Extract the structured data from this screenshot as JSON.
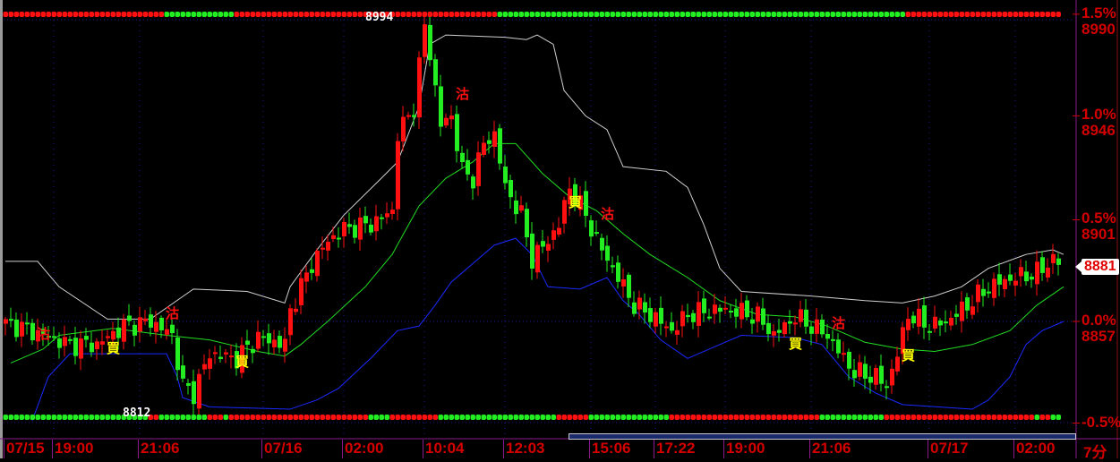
{
  "chart_data": {
    "type": "candlestick",
    "bar_count": 197,
    "closes_keypoints": [
      [
        1,
        8856
      ],
      [
        7,
        8851
      ],
      [
        12,
        8847
      ],
      [
        17,
        8847
      ],
      [
        22,
        8855
      ],
      [
        27,
        8857
      ],
      [
        31,
        8851
      ],
      [
        33,
        8829
      ],
      [
        35,
        8826
      ],
      [
        38,
        8843
      ],
      [
        43,
        8841
      ],
      [
        47,
        8850
      ],
      [
        52,
        8847
      ],
      [
        53,
        8862
      ],
      [
        57,
        8882
      ],
      [
        60,
        8892
      ],
      [
        63,
        8897
      ],
      [
        68,
        8899
      ],
      [
        72,
        8905
      ],
      [
        73,
        8938
      ],
      [
        76,
        8950
      ],
      [
        78,
        8985
      ],
      [
        79,
        8973
      ],
      [
        81,
        8942
      ],
      [
        83,
        8946
      ],
      [
        85,
        8922
      ],
      [
        87,
        8919
      ],
      [
        89,
        8934
      ],
      [
        91,
        8938
      ],
      [
        93,
        8915
      ],
      [
        96,
        8903
      ],
      [
        98,
        8884
      ],
      [
        101,
        8892
      ],
      [
        103,
        8899
      ],
      [
        105,
        8915
      ],
      [
        108,
        8903
      ],
      [
        110,
        8892
      ],
      [
        113,
        8880
      ],
      [
        117,
        8864
      ],
      [
        120,
        8860
      ],
      [
        124,
        8853
      ],
      [
        127,
        8860
      ],
      [
        132,
        8862
      ],
      [
        135,
        8862
      ],
      [
        140,
        8859
      ],
      [
        143,
        8851
      ],
      [
        147,
        8859
      ],
      [
        150,
        8855
      ],
      [
        153,
        8851
      ],
      [
        156,
        8841
      ],
      [
        158,
        8835
      ],
      [
        162,
        8833
      ],
      [
        164,
        8829
      ],
      [
        166,
        8843
      ],
      [
        168,
        8860
      ],
      [
        172,
        8855
      ],
      [
        175,
        8857
      ],
      [
        178,
        8862
      ],
      [
        182,
        8870
      ],
      [
        185,
        8874
      ],
      [
        188,
        8876
      ],
      [
        192,
        8878
      ],
      [
        195,
        8884
      ],
      [
        197,
        8881
      ]
    ],
    "upper_band": [
      [
        0,
        8883
      ],
      [
        6,
        8883
      ],
      [
        10,
        8872
      ],
      [
        19,
        8858
      ],
      [
        27,
        8858
      ],
      [
        35,
        8871
      ],
      [
        45,
        8870
      ],
      [
        52,
        8865
      ],
      [
        53,
        8872
      ],
      [
        58,
        8888
      ],
      [
        63,
        8903
      ],
      [
        70,
        8919
      ],
      [
        73,
        8926
      ],
      [
        77,
        8950
      ],
      [
        79,
        8977
      ],
      [
        82,
        8981
      ],
      [
        93,
        8980
      ],
      [
        97,
        8979
      ],
      [
        99,
        8981
      ],
      [
        102,
        8977
      ],
      [
        104,
        8957
      ],
      [
        108,
        8946
      ],
      [
        112,
        8940
      ],
      [
        115,
        8924
      ],
      [
        123,
        8922
      ],
      [
        127,
        8915
      ],
      [
        130,
        8899
      ],
      [
        133,
        8880
      ],
      [
        137,
        8870
      ],
      [
        150,
        8868
      ],
      [
        160,
        8866
      ],
      [
        167,
        8865
      ],
      [
        173,
        8868
      ],
      [
        178,
        8872
      ],
      [
        183,
        8880
      ],
      [
        190,
        8886
      ],
      [
        195,
        8888
      ],
      [
        197,
        8886
      ]
    ],
    "middle_band": [
      [
        1,
        8839
      ],
      [
        7,
        8845
      ],
      [
        10,
        8851
      ],
      [
        20,
        8854
      ],
      [
        30,
        8851
      ],
      [
        38,
        8849
      ],
      [
        47,
        8844
      ],
      [
        52,
        8842
      ],
      [
        55,
        8847
      ],
      [
        60,
        8857
      ],
      [
        67,
        8872
      ],
      [
        72,
        8886
      ],
      [
        77,
        8907
      ],
      [
        82,
        8919
      ],
      [
        87,
        8926
      ],
      [
        91,
        8934
      ],
      [
        95,
        8934
      ],
      [
        100,
        8921
      ],
      [
        105,
        8911
      ],
      [
        110,
        8905
      ],
      [
        115,
        8895
      ],
      [
        120,
        8886
      ],
      [
        127,
        8876
      ],
      [
        133,
        8866
      ],
      [
        140,
        8860
      ],
      [
        147,
        8859
      ],
      [
        153,
        8855
      ],
      [
        160,
        8848
      ],
      [
        167,
        8845
      ],
      [
        173,
        8844
      ],
      [
        180,
        8847
      ],
      [
        187,
        8853
      ],
      [
        192,
        8864
      ],
      [
        197,
        8872
      ]
    ],
    "lower_band": [
      [
        5,
        8814
      ],
      [
        8,
        8833
      ],
      [
        12,
        8843
      ],
      [
        30,
        8843
      ],
      [
        32,
        8833
      ],
      [
        33,
        8824
      ],
      [
        38,
        8820
      ],
      [
        53,
        8819
      ],
      [
        58,
        8823
      ],
      [
        62,
        8828
      ],
      [
        68,
        8841
      ],
      [
        73,
        8853
      ],
      [
        77,
        8855
      ],
      [
        80,
        8864
      ],
      [
        83,
        8874
      ],
      [
        87,
        8882
      ],
      [
        91,
        8890
      ],
      [
        95,
        8893
      ],
      [
        98,
        8886
      ],
      [
        101,
        8872
      ],
      [
        107,
        8871
      ],
      [
        112,
        8876
      ],
      [
        115,
        8866
      ],
      [
        118,
        8860
      ],
      [
        122,
        8849
      ],
      [
        127,
        8841
      ],
      [
        133,
        8847
      ],
      [
        137,
        8851
      ],
      [
        147,
        8850
      ],
      [
        152,
        8847
      ],
      [
        157,
        8833
      ],
      [
        162,
        8826
      ],
      [
        167,
        8821
      ],
      [
        180,
        8819
      ],
      [
        183,
        8823
      ],
      [
        187,
        8833
      ],
      [
        190,
        8847
      ],
      [
        193,
        8853
      ],
      [
        197,
        8857
      ]
    ],
    "top_signal_strip": [
      [
        "red",
        0,
        29
      ],
      [
        "green",
        30,
        42
      ],
      [
        "red",
        43,
        91
      ],
      [
        "green",
        92,
        167
      ],
      [
        "red",
        168,
        196
      ]
    ],
    "bottom_signal_strip": [
      [
        "green",
        0,
        26
      ],
      [
        "red",
        27,
        28
      ],
      [
        "green",
        29,
        37
      ],
      [
        "red",
        38,
        40
      ],
      [
        "green",
        41,
        41
      ],
      [
        "red",
        42,
        67
      ],
      [
        "green",
        68,
        71
      ],
      [
        "red",
        72,
        80
      ],
      [
        "green",
        81,
        102
      ],
      [
        "red",
        103,
        108
      ],
      [
        "green",
        109,
        123
      ],
      [
        "red",
        124,
        151
      ],
      [
        "green",
        152,
        163
      ],
      [
        "red",
        164,
        191
      ],
      [
        "green",
        192,
        192
      ],
      [
        "red",
        193,
        194
      ],
      [
        "green",
        195,
        196
      ]
    ],
    "signals": [
      {
        "type": "sell",
        "label": "沽",
        "bar": 7,
        "price": 8851
      },
      {
        "type": "sell",
        "label": "沽",
        "bar": 31,
        "price": 8860
      },
      {
        "type": "sell",
        "label": "沽",
        "bar": 85,
        "price": 8955
      },
      {
        "type": "sell",
        "label": "沽",
        "bar": 112,
        "price": 8903
      },
      {
        "type": "sell",
        "label": "沽",
        "bar": 155,
        "price": 8856
      },
      {
        "type": "buy",
        "label": "買",
        "bar": 20,
        "price": 8845
      },
      {
        "type": "buy",
        "label": "買",
        "bar": 44,
        "price": 8839
      },
      {
        "type": "buy",
        "label": "買",
        "bar": 106,
        "price": 8908
      },
      {
        "type": "buy",
        "label": "買",
        "bar": 147,
        "price": 8847
      },
      {
        "type": "buy",
        "label": "買",
        "bar": 168,
        "price": 8842
      }
    ],
    "high_label": "8994",
    "low_label": "8812",
    "y_axis": {
      "ticks": [
        {
          "pct": "1.5%",
          "price": "8990",
          "value": 8990
        },
        {
          "pct": "1.0%",
          "price": "8946",
          "value": 8946
        },
        {
          "pct": "0.5%",
          "price": "8901",
          "value": 8901
        },
        {
          "pct": "0.0%",
          "price": "8857",
          "value": 8857
        },
        {
          "pct": "-0.5%",
          "value": 8813
        }
      ],
      "ylim": [
        8800,
        8998
      ]
    },
    "x_axis": {
      "ticks": [
        {
          "label": "07/15",
          "bar": 0
        },
        {
          "label": "19:00",
          "bar": 9
        },
        {
          "label": "21:06",
          "bar": 25
        },
        {
          "label": "07/16",
          "bar": 48
        },
        {
          "label": "02:00",
          "bar": 63
        },
        {
          "label": "10:04",
          "bar": 78
        },
        {
          "label": "12:03",
          "bar": 93
        },
        {
          "label": "15:06",
          "bar": 109
        },
        {
          "label": "17:22",
          "bar": 121
        },
        {
          "label": "19:00",
          "bar": 134
        },
        {
          "label": "21:06",
          "bar": 150
        },
        {
          "label": "07/17",
          "bar": 172
        },
        {
          "label": "02:00",
          "bar": 188
        }
      ]
    },
    "current_price": "8881",
    "period": "7分",
    "colors": {
      "up": "#ff1010",
      "down": "#22ee22",
      "upper": "#d0d0d0",
      "middle": "#22dd22",
      "lower": "#1a2aff",
      "grid": "#1a1aa0",
      "axis": "#d40000"
    }
  }
}
